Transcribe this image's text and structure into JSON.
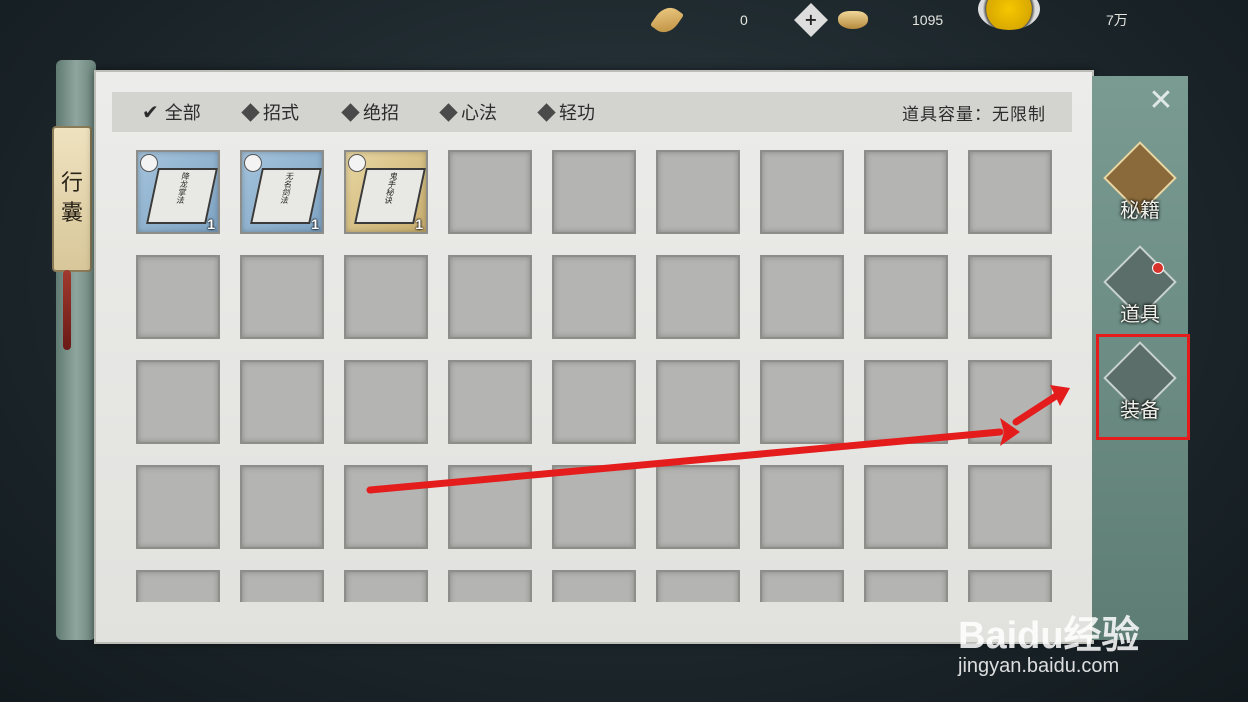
{
  "currency": {
    "feather_icon": "feather-icon",
    "feather_value": "0",
    "add_icon": "plus-icon",
    "silver_icon": "ingot-icon",
    "silver_value": "1095",
    "coin_icon": "gold-coin-icon",
    "coin_value": "7万"
  },
  "scroll_label": [
    "行",
    "囊"
  ],
  "tabs": [
    {
      "label": "全部",
      "selected": true
    },
    {
      "label": "招式",
      "selected": false
    },
    {
      "label": "绝招",
      "selected": false
    },
    {
      "label": "心法",
      "selected": false
    },
    {
      "label": "轻功",
      "selected": false
    }
  ],
  "capacity": "道具容量：无限制",
  "items": [
    {
      "title": "降龙掌法",
      "rarity": "blue",
      "qty": "1"
    },
    {
      "title": "无名剑法",
      "rarity": "blue",
      "qty": "1"
    },
    {
      "title": "鬼手秘诀",
      "rarity": "gold",
      "qty": "1"
    }
  ],
  "side_menu": [
    {
      "label": "秘籍",
      "active": true,
      "icon": "scroll-book-icon"
    },
    {
      "label": "道具",
      "active": false,
      "icon": "gourd-icon",
      "notification": true
    },
    {
      "label": "装备",
      "active": false,
      "icon": "sword-armor-icon",
      "highlighted": true
    }
  ],
  "close_icon": "close-icon",
  "watermark": {
    "main": "Baidu经验",
    "sub": "jingyan.baidu.com"
  },
  "colors": {
    "annotation_red": "#e41c1c",
    "panel_bg": "#e6e6e3",
    "side_bg": "#6f8f86"
  }
}
